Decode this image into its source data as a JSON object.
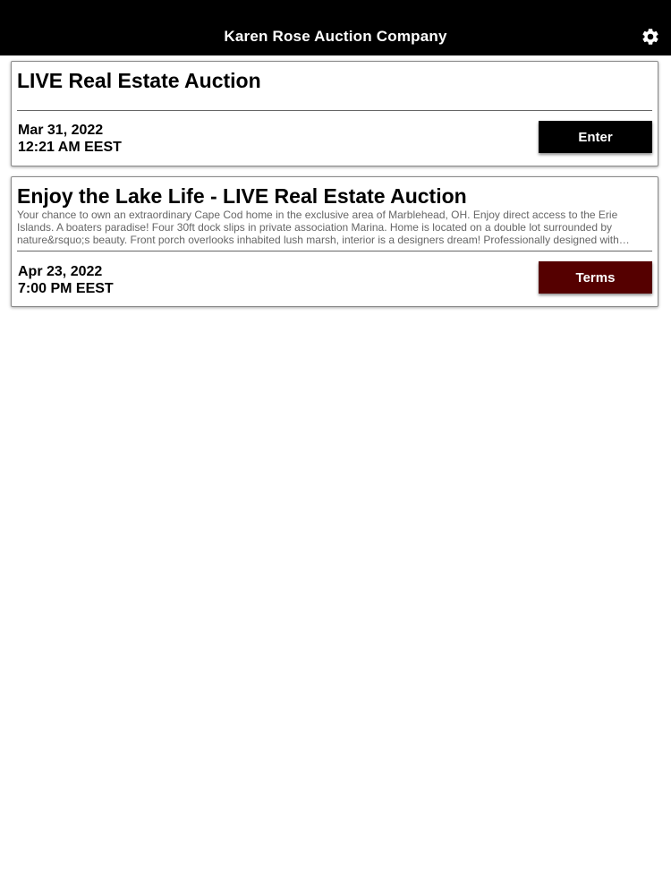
{
  "header": {
    "title": "Karen Rose Auction Company",
    "settings_icon": "gear-icon"
  },
  "auctions": [
    {
      "title": "LIVE Real Estate Auction",
      "description": "",
      "date": "Mar 31, 2022",
      "time": "12:21 AM EEST",
      "button_label": "Enter",
      "button_color": "#000000"
    },
    {
      "title": "Enjoy the Lake Life - LIVE Real Estate Auction",
      "description": "Your chance to own an extraordinary Cape Cod home in the exclusive area of Marblehead, OH. Enjoy direct access to the Erie Islands. A boaters paradise! Four 30ft dock slips in private association Marina. Home is located on a double lot surrounded by nature&rsquo;s beauty. Front porch overlooks inhabited lush marsh, interior is a designers dream! Professionally designed with…",
      "date": "Apr 23, 2022",
      "time": "7:00 PM EEST",
      "button_label": "Terms",
      "button_color": "#550000"
    }
  ]
}
